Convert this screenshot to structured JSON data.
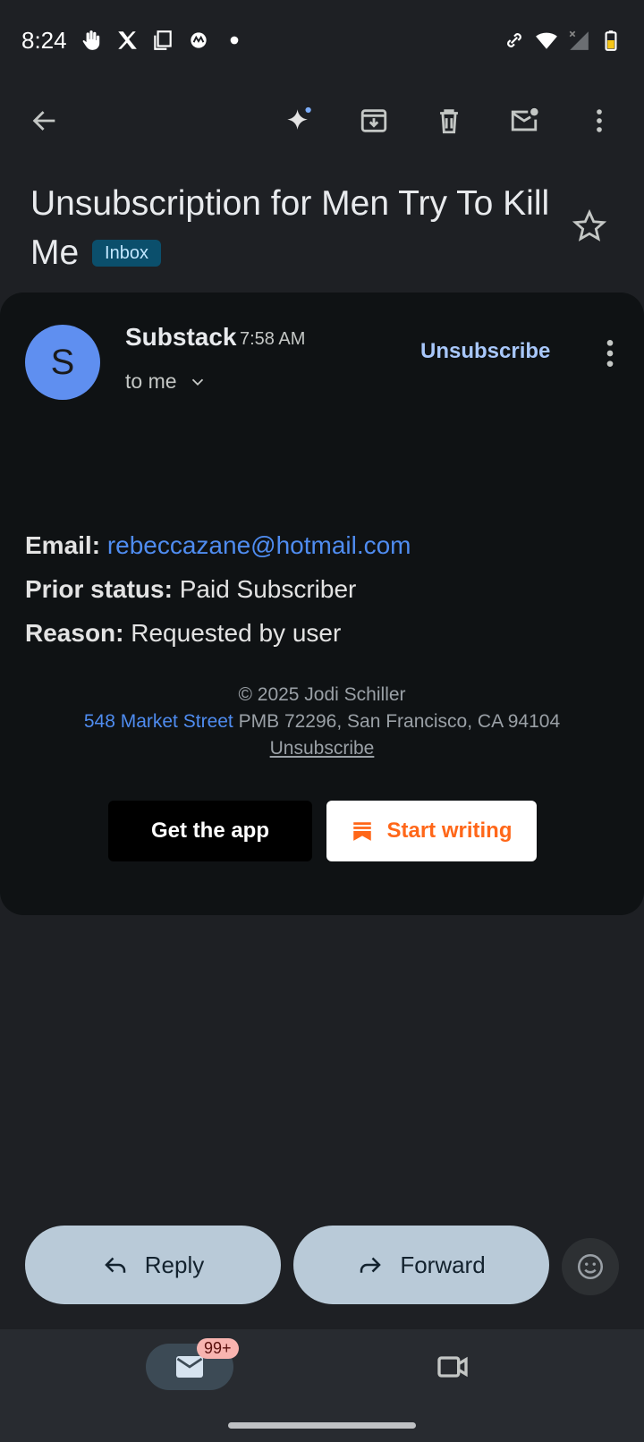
{
  "status_bar": {
    "time": "8:24",
    "left_icons": [
      "hand-icon",
      "x-icon",
      "copy-icon",
      "motorola-icon",
      "dot-icon"
    ],
    "right_icons": [
      "link-icon",
      "wifi-icon",
      "signal-icon",
      "battery-icon"
    ]
  },
  "toolbar": {
    "icons": [
      "back-arrow-icon",
      "gemini-sparkle-icon",
      "archive-icon",
      "delete-icon",
      "mark-unread-icon",
      "more-vert-icon"
    ]
  },
  "email": {
    "subject": "Unsubscription for Men Try To Kill Me",
    "label": "Inbox",
    "sender_initial": "S",
    "sender": "Substack",
    "time": "7:58 AM",
    "recipient": "to me",
    "unsubscribe": "Unsubscribe",
    "fields": {
      "email_label": "Email:",
      "email_value": "rebeccazane@hotmail.com",
      "status_label": "Prior status:",
      "status_value": "Paid Subscriber",
      "reason_label": "Reason:",
      "reason_value": "Requested by user"
    },
    "footer": {
      "copyright": "© 2025 Jodi Schiller",
      "address_link": "548 Market Street",
      "address_rest": " PMB 72296, San Francisco, CA 94104",
      "unsubscribe": "Unsubscribe"
    },
    "buttons": {
      "get_app": "Get the app",
      "start_writing": "Start writing"
    }
  },
  "actions": {
    "reply": "Reply",
    "forward": "Forward"
  },
  "nav": {
    "mail_badge": "99+"
  },
  "colors": {
    "background": "#1e2024",
    "card": "#0f1214",
    "link": "#4f8cf0",
    "substack_orange": "#ff6719",
    "pill": "#b9cad8"
  }
}
